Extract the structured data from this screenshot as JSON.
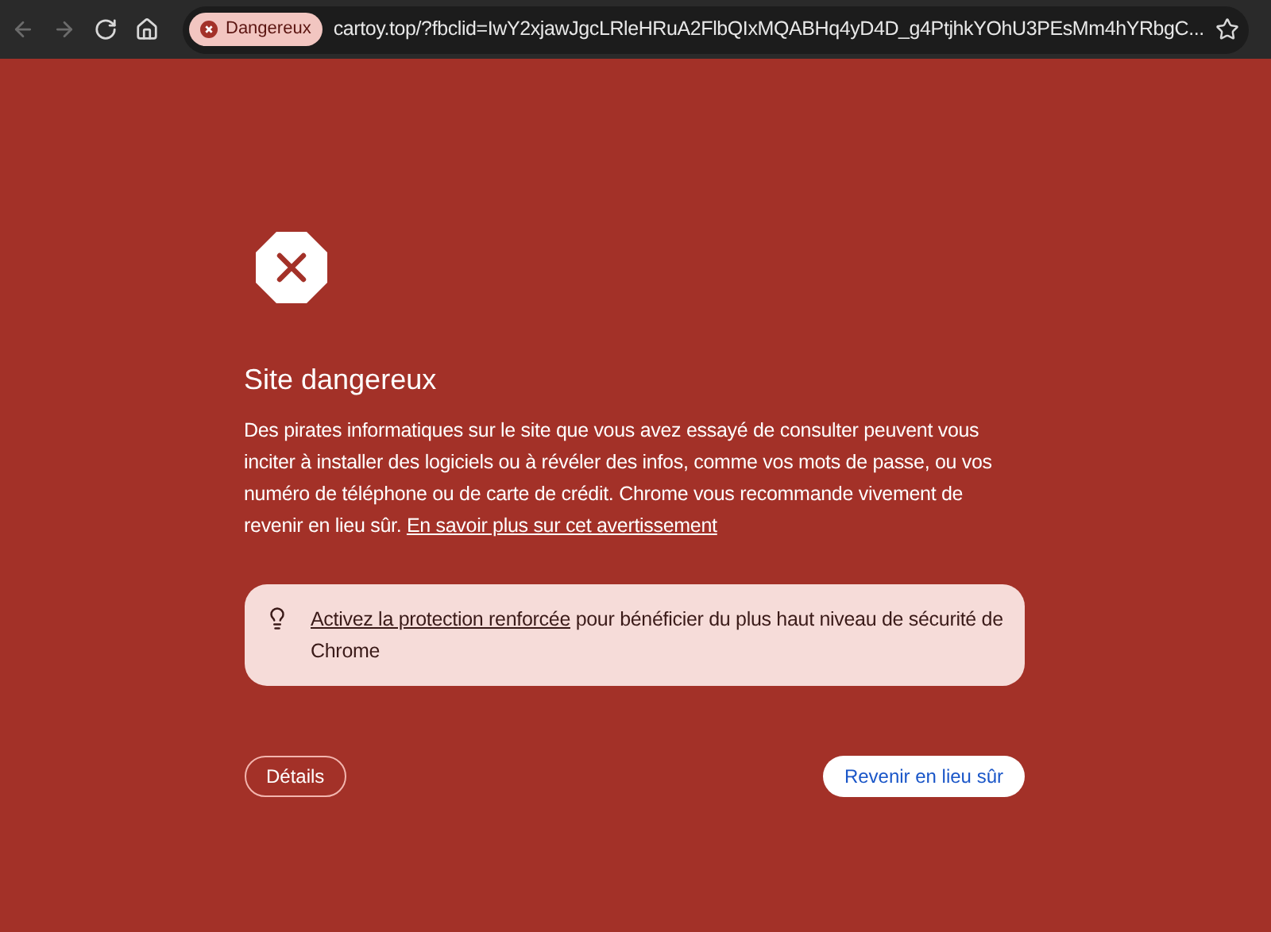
{
  "toolbar": {
    "nav": [
      {
        "kind": "back",
        "disabled": true
      },
      {
        "kind": "forward",
        "disabled": true
      },
      {
        "kind": "reload",
        "disabled": false
      },
      {
        "kind": "home",
        "disabled": false
      }
    ],
    "security_chip": {
      "label": "Dangereux"
    },
    "url": "cartoy.top/?fbclid=IwY2xjawJgcLRleHRuA2FlbQIxMQABHq4yD4D_g4PtjhkYOhU3PEsMm4hYRbgC..."
  },
  "page": {
    "title": "Site dangereux",
    "body": "Des pirates informatiques sur le site que vous avez essayé de consulter peuvent vous inciter à installer des logiciels ou à révéler des infos, comme vos mots de passe, ou vos numéro de téléphone ou de carte de crédit. Chrome vous recommande vivement de revenir en lieu sûr.",
    "body_link": "En savoir plus sur cet avertissement",
    "tip": {
      "link": "Activez la protection renforcée",
      "text": "pour bénéficier du plus haut niveau de sécurité de Chrome"
    },
    "buttons": [
      {
        "label": "Détails",
        "kind": "secondary"
      },
      {
        "label": "Revenir en lieu sûr",
        "kind": "primary"
      }
    ]
  }
}
